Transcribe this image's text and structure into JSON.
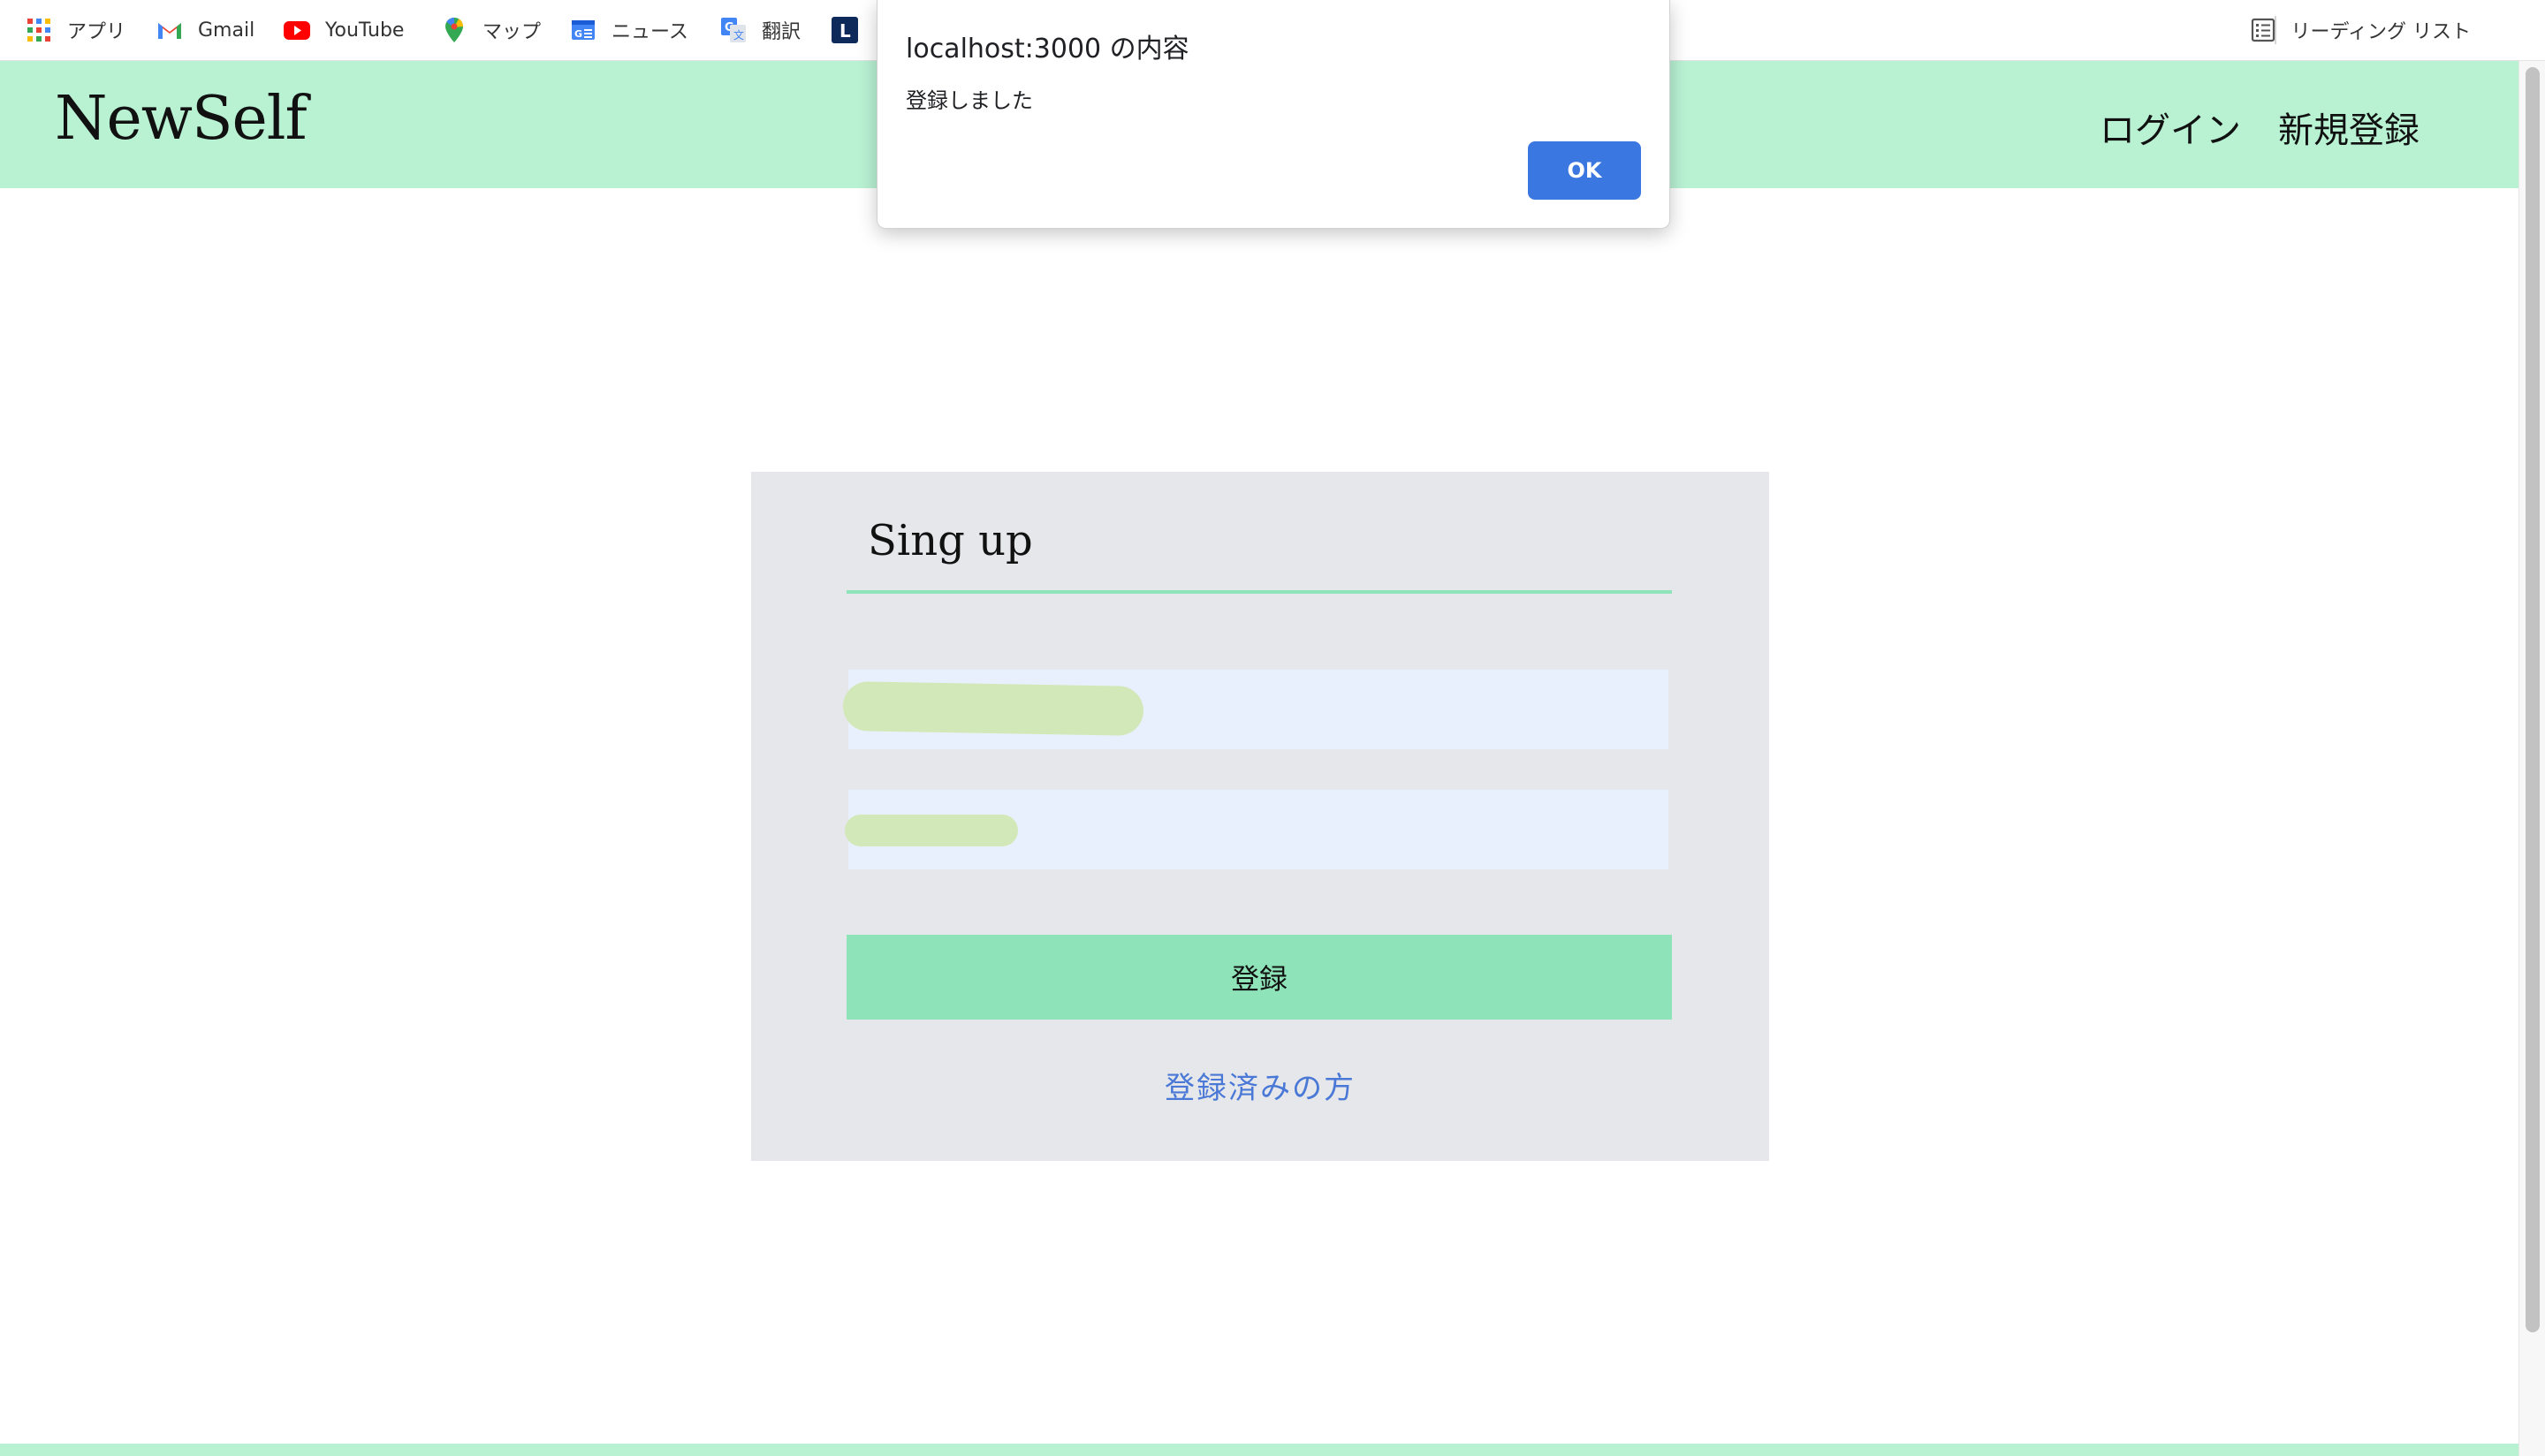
{
  "bookmarks": {
    "items": [
      {
        "label": "アプリ",
        "icon": "apps-grid-icon"
      },
      {
        "label": "Gmail",
        "icon": "gmail-icon"
      },
      {
        "label": "YouTube",
        "icon": "youtube-icon"
      },
      {
        "label": "マップ",
        "icon": "maps-pin-icon"
      },
      {
        "label": "ニュース",
        "icon": "google-news-icon"
      },
      {
        "label": "翻訳",
        "icon": "translate-icon"
      },
      {
        "label": "",
        "icon": "l-logo-icon"
      }
    ],
    "reading_list": "リーディング リスト"
  },
  "header": {
    "logo": "NewSelf",
    "nav": {
      "login": "ログイン",
      "signup": "新規登録"
    },
    "color": "#b9f1d3"
  },
  "signup_card": {
    "title": "Sing up",
    "email_value": "",
    "password_value": "",
    "submit_label": "登録",
    "login_link": "登録済みの方",
    "accent_color": "#8fe3b8",
    "link_color": "#4a78d6"
  },
  "alert": {
    "title": "localhost:3000 の内容",
    "message": "登録しました",
    "ok_label": "OK",
    "button_color": "#3b77e0"
  }
}
